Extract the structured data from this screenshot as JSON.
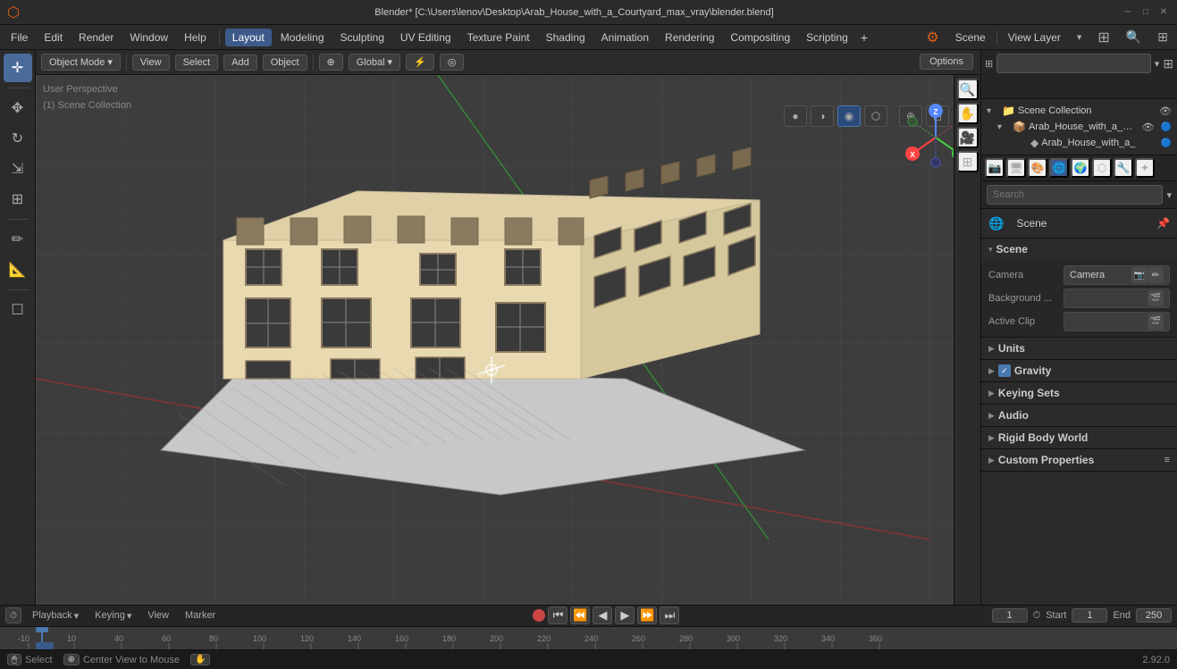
{
  "titlebar": {
    "title": "Blender* [C:\\Users\\lenov\\Desktop\\Arab_House_with_a_Courtyard_max_vray\\blender.blend]",
    "minimize": "─",
    "restore": "□",
    "close": "✕"
  },
  "menubar": {
    "blender_logo": "⬡",
    "items": [
      "File",
      "Edit",
      "Render",
      "Window",
      "Help"
    ],
    "tabs": [
      "Layout",
      "Modeling",
      "Sculpting",
      "UV Editing",
      "Texture Paint",
      "Shading",
      "Animation",
      "Rendering",
      "Compositing",
      "Scripting"
    ],
    "active_tab": "Layout",
    "plus_label": "+",
    "engine_icon": "⚙",
    "engine_name": "Scene",
    "view_layer_label": "View Layer",
    "search_icon": "🔍",
    "filter_icon": "⊞"
  },
  "viewport_header": {
    "mode_label": "Object Mode",
    "mode_arrow": "▾",
    "view_label": "View",
    "select_label": "Select",
    "add_label": "Add",
    "object_label": "Object",
    "transform_icon": "⊕",
    "global_label": "Global",
    "snap_icon": "⚡",
    "proportional_icon": "◎",
    "options_label": "Options"
  },
  "left_tools": {
    "cursor_icon": "✛",
    "move_icon": "✥",
    "rotate_icon": "↻",
    "scale_icon": "⇲",
    "transform_icon": "⊞",
    "annotate_icon": "✏",
    "measure_icon": "📐",
    "add_cube_icon": "☐"
  },
  "view_info": {
    "perspective": "User Perspective",
    "collection": "(1) Scene Collection"
  },
  "right_icons": {
    "magnify": "🔍",
    "hand": "✋",
    "camera": "🎥",
    "grid": "⊞"
  },
  "right_panel": {
    "top": {
      "label": "Scene Collection",
      "search_placeholder": "Search",
      "filter_icon": "⊞",
      "dropdown_icon": "▾"
    },
    "collections": [
      {
        "name": "Scene Collection",
        "indent": 0,
        "icon": "📁",
        "eye": true,
        "arrow": "▾"
      },
      {
        "name": "Arab_House_with_a_Cou",
        "indent": 1,
        "icon": "📦",
        "eye": true,
        "arrow": "▾"
      },
      {
        "name": "Arab_House_with_a_",
        "indent": 2,
        "icon": "◆",
        "eye": false,
        "arrow": ""
      }
    ],
    "props_icons": [
      "🎬",
      "🌐",
      "📷",
      "🔧",
      "🎨",
      "🌊",
      "💡",
      "⚙"
    ],
    "active_prop": 0,
    "scene_label": "Scene",
    "pin_icon": "📌",
    "sections": [
      {
        "title": "Scene",
        "expanded": true,
        "items": [
          {
            "label": "Camera",
            "value": "Camera",
            "icons": [
              "📷",
              "✏"
            ]
          },
          {
            "label": "Background ...",
            "value": "",
            "icons": [
              "🎬"
            ]
          },
          {
            "label": "Active Clip",
            "value": "",
            "icons": [
              "🎬"
            ]
          }
        ]
      },
      {
        "title": "Units",
        "expanded": false,
        "items": []
      },
      {
        "title": "Gravity",
        "expanded": false,
        "checkbox": true,
        "checked": true,
        "items": []
      },
      {
        "title": "Keying Sets",
        "expanded": false,
        "items": []
      },
      {
        "title": "Audio",
        "expanded": false,
        "items": []
      },
      {
        "title": "Rigid Body World",
        "expanded": false,
        "items": []
      },
      {
        "title": "Custom Properties",
        "expanded": false,
        "items": []
      }
    ]
  },
  "timeline": {
    "playback_label": "Playback",
    "keying_label": "Keying",
    "view_label": "View",
    "marker_label": "Marker",
    "record_icon": "●",
    "skip_start": "⏮",
    "prev_frame": "⏪",
    "play_back": "◀",
    "play_fwd": "▶",
    "next_frame": "⏩",
    "skip_end": "⏭",
    "current_frame": "1",
    "fps_icon": "⏱",
    "start_label": "Start",
    "start_val": "1",
    "end_label": "End",
    "end_val": "250"
  },
  "statusbar": {
    "mouse_icon": "🖱",
    "select_label": "Select",
    "center_icon": "⊕",
    "center_label": "Center View to Mouse",
    "grab_icon": "✋",
    "version": "2.92.0"
  },
  "colors": {
    "active_tab_bg": "#3d5a8a",
    "bg_dark": "#1a1a1a",
    "bg_medium": "#2b2b2b",
    "bg_panel": "#252525",
    "accent": "#4a7ab0",
    "viewport_bg": "#3d3d3d",
    "grid_line": "#454545",
    "x_axis": "#cc3333",
    "y_axis": "#339933",
    "building_color": "#e8d9b0"
  }
}
